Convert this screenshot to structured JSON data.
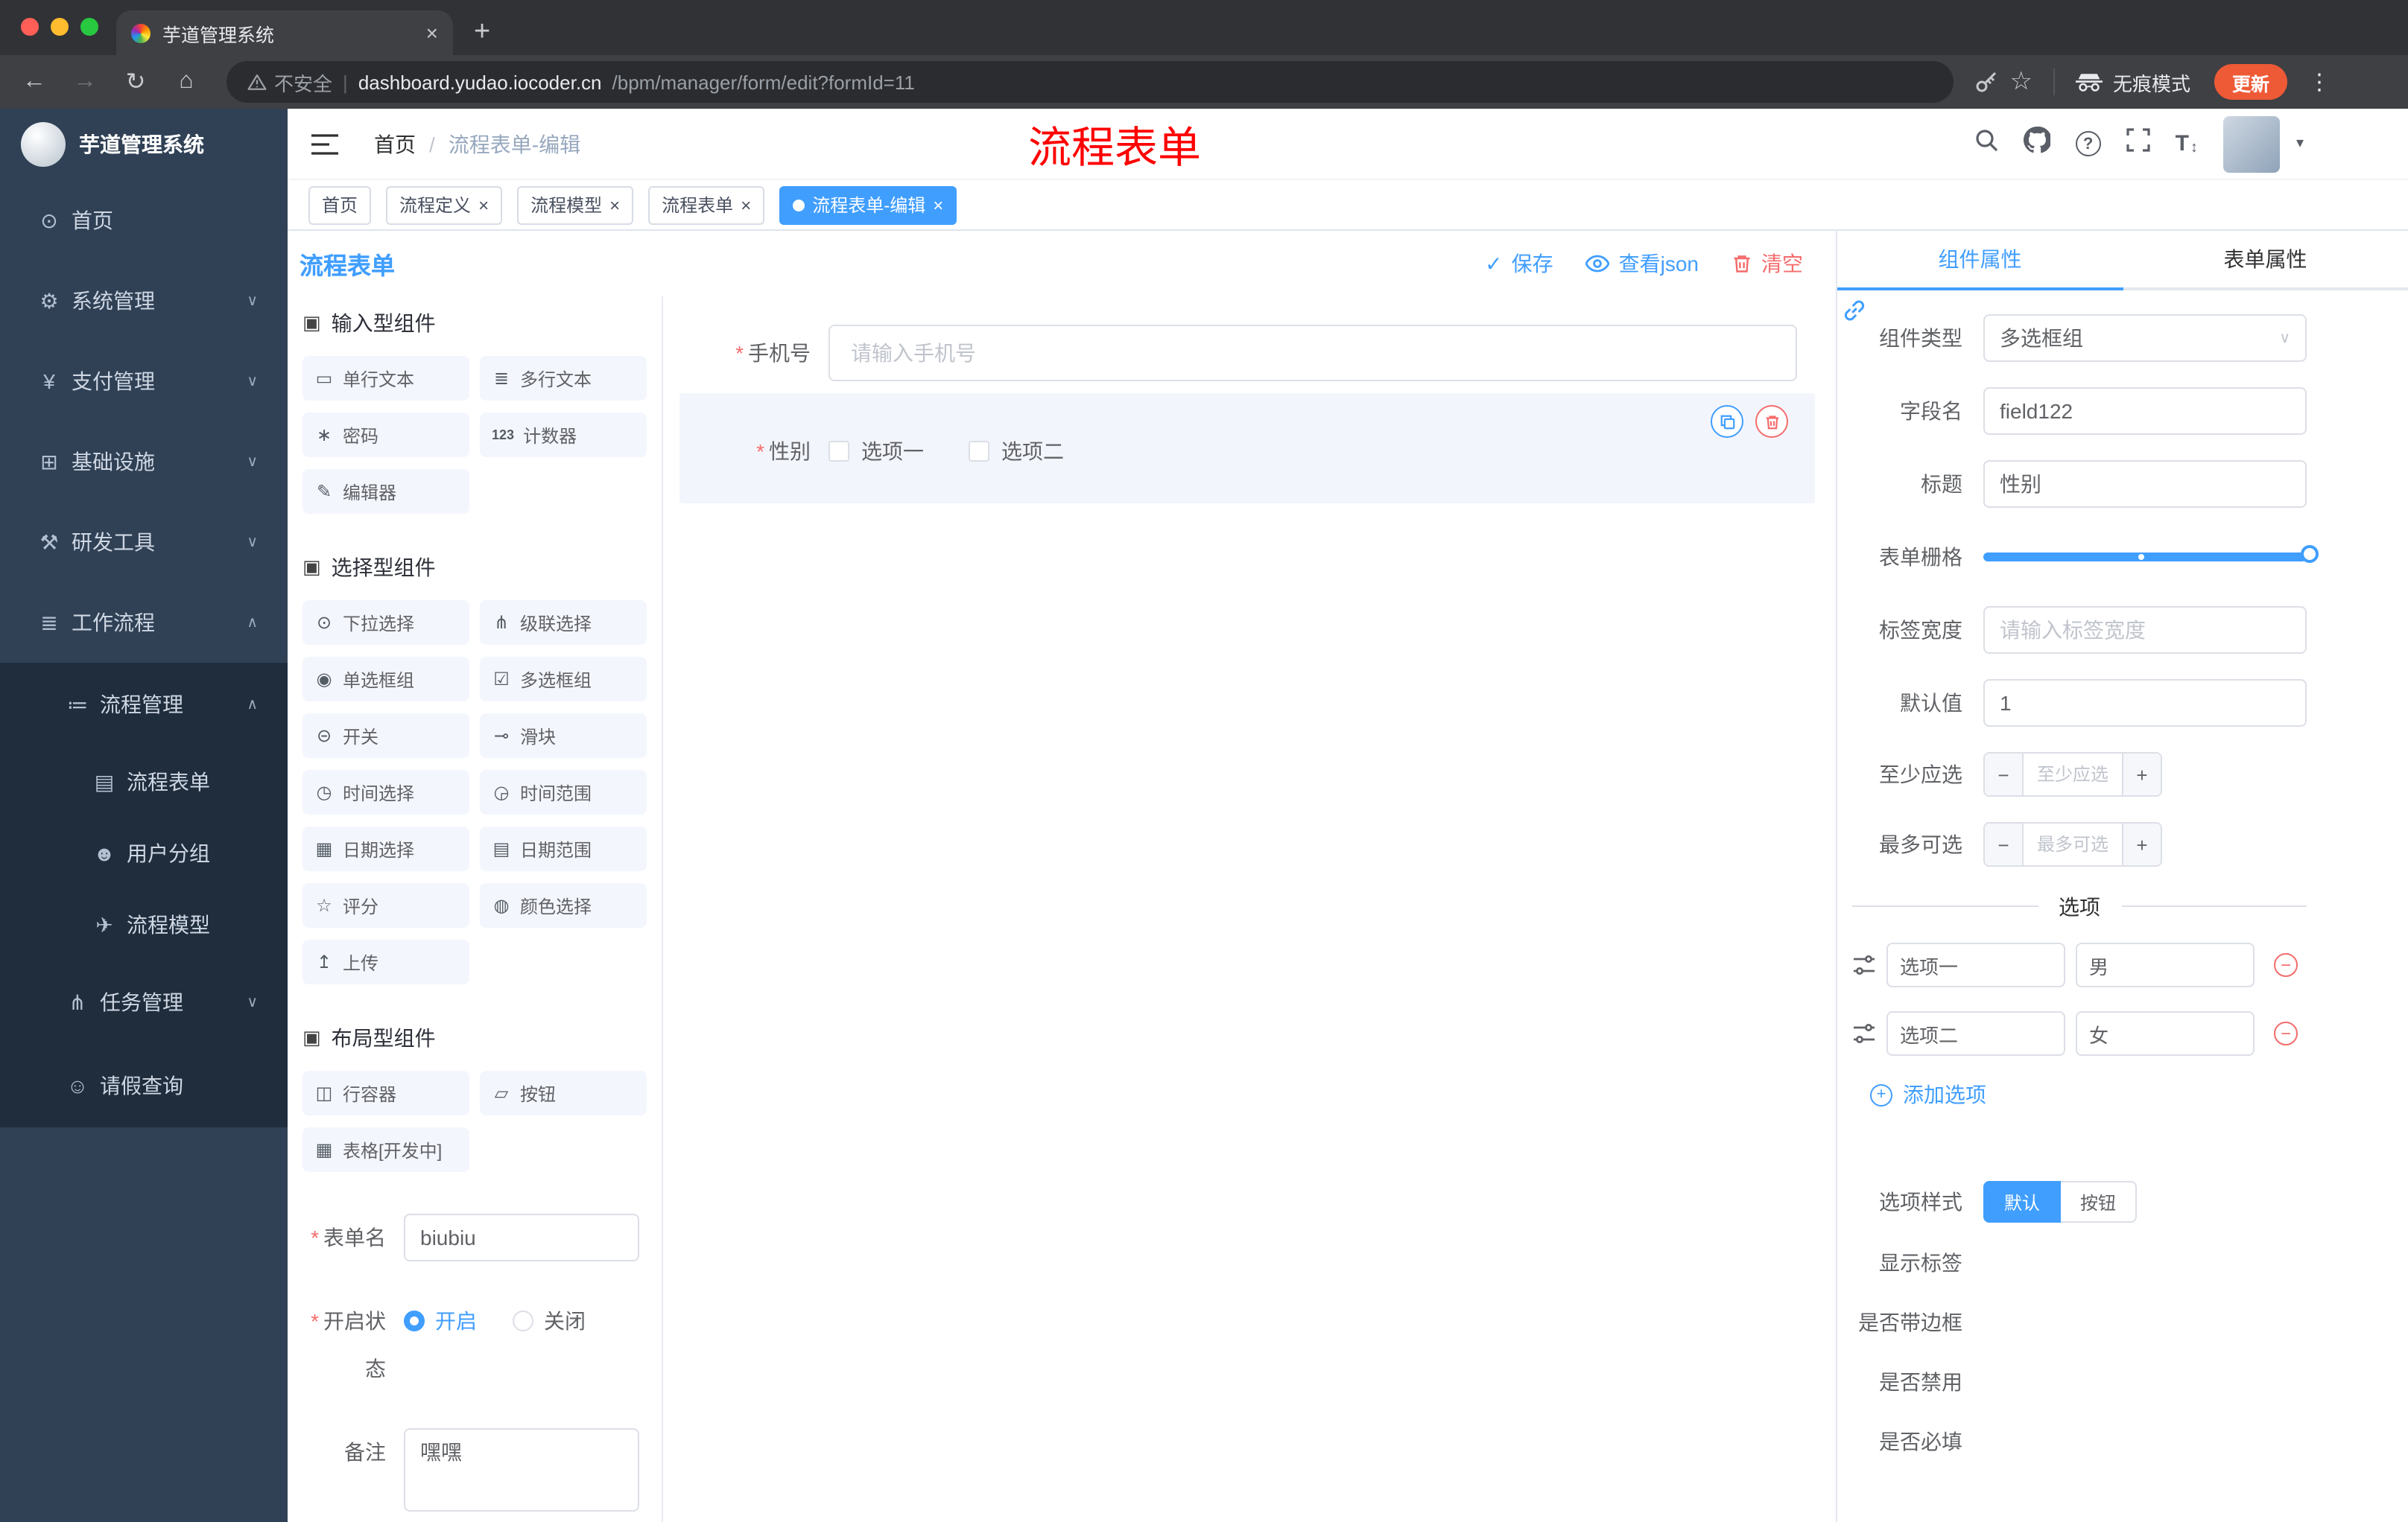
{
  "browser": {
    "tab_title": "芋道管理系统",
    "new_tab": "+",
    "address": {
      "warning_text": "不安全",
      "separator": "|",
      "host": "dashboard.yudao.iocoder.cn",
      "path": "/bpm/manager/form/edit?formId=11"
    },
    "incognito_label": "无痕模式",
    "update_button": "更新"
  },
  "icons": {
    "back": "←",
    "forward": "→",
    "reload": "↻",
    "home": "⌂",
    "star": "☆",
    "menu_dots": "⋮",
    "close": "×",
    "chevron_down": "∨",
    "chevron_up": "∧",
    "select_caret": "∨",
    "caret_down": "▾",
    "question_mark": "?",
    "font_size": "T",
    "font_size_arrows": "↕",
    "check": "✓"
  },
  "app_header": {
    "breadcrumb": {
      "root": "首页",
      "separator": "/",
      "current": "流程表单-编辑"
    },
    "annotation": "流程表单"
  },
  "page_tabs": [
    {
      "label": "首页"
    },
    {
      "label": "流程定义"
    },
    {
      "label": "流程模型"
    },
    {
      "label": "流程表单"
    },
    {
      "label": "流程表单-编辑"
    }
  ],
  "sidebar": {
    "logo_title": "芋道管理系统",
    "items": [
      {
        "label": "首页",
        "icon": "⊙"
      },
      {
        "label": "系统管理",
        "icon": "⚙"
      },
      {
        "label": "支付管理",
        "icon": "¥"
      },
      {
        "label": "基础设施",
        "icon": "⊞"
      },
      {
        "label": "研发工具",
        "icon": "⚒"
      },
      {
        "label": "工作流程",
        "icon": "≣"
      },
      {
        "label": "流程管理",
        "icon": "≔"
      },
      {
        "label": "流程表单",
        "icon": "▤"
      },
      {
        "label": "用户分组",
        "icon": "☻"
      },
      {
        "label": "流程模型",
        "icon": "✈"
      },
      {
        "label": "任务管理",
        "icon": "⋔"
      },
      {
        "label": "请假查询",
        "icon": "☺"
      }
    ]
  },
  "toolbar": {
    "page_title": "流程表单",
    "save_label": "保存",
    "view_json_label": "查看json",
    "clear_label": "清空"
  },
  "palette": {
    "groups": [
      {
        "title": "输入型组件",
        "icon": "▣",
        "items": [
          {
            "label": "单行文本",
            "icon": "▭"
          },
          {
            "label": "多行文本",
            "icon": "≣"
          },
          {
            "label": "密码",
            "icon": "∗"
          },
          {
            "label": "计数器",
            "icon": "123"
          },
          {
            "label": "编辑器",
            "icon": "✎"
          }
        ]
      },
      {
        "title": "选择型组件",
        "icon": "▣",
        "items": [
          {
            "label": "下拉选择",
            "icon": "⊙"
          },
          {
            "label": "级联选择",
            "icon": "⋔"
          },
          {
            "label": "单选框组",
            "icon": "◉"
          },
          {
            "label": "多选框组",
            "icon": "☑"
          },
          {
            "label": "开关",
            "icon": "⊝"
          },
          {
            "label": "滑块",
            "icon": "⊸"
          },
          {
            "label": "时间选择",
            "icon": "◷"
          },
          {
            "label": "时间范围",
            "icon": "◶"
          },
          {
            "label": "日期选择",
            "icon": "▦"
          },
          {
            "label": "日期范围",
            "icon": "▤"
          },
          {
            "label": "评分",
            "icon": "☆"
          },
          {
            "label": "颜色选择",
            "icon": "◍"
          },
          {
            "label": "上传",
            "icon": "↥"
          }
        ]
      },
      {
        "title": "布局型组件",
        "icon": "▣",
        "items": [
          {
            "label": "行容器",
            "icon": "◫"
          },
          {
            "label": "按钮",
            "icon": "▱"
          },
          {
            "label": "表格[开发中]",
            "icon": "▦"
          }
        ]
      }
    ]
  },
  "form_settings": {
    "form_name": {
      "label": "表单名",
      "value": "biubiu"
    },
    "status": {
      "label": "开启状态",
      "options": [
        "开启",
        "关闭"
      ],
      "selected": "开启"
    },
    "remark": {
      "label": "备注",
      "value": "嘿嘿"
    }
  },
  "canvas": {
    "phone_field": {
      "label": "手机号",
      "placeholder": "请输入手机号"
    },
    "gender_widget": {
      "label": "性别",
      "options": [
        "选项一",
        "选项二"
      ]
    }
  },
  "panel": {
    "tabs": [
      {
        "label": "组件属性"
      },
      {
        "label": "表单属性"
      }
    ],
    "component_type": {
      "label": "组件类型",
      "value": "多选框组"
    },
    "field_name": {
      "label": "字段名",
      "value": "field122"
    },
    "title": {
      "label": "标题",
      "value": "性别"
    },
    "form_grid": {
      "label": "表单栅格"
    },
    "label_width": {
      "label": "标签宽度",
      "placeholder": "请输入标签宽度"
    },
    "default_value": {
      "label": "默认值",
      "value": "1"
    },
    "min_select": {
      "label": "至少应选",
      "placeholder": "至少应选",
      "minus": "−",
      "plus": "+"
    },
    "max_select": {
      "label": "最多可选",
      "placeholder": "最多可选",
      "minus": "−",
      "plus": "+"
    },
    "options_section": {
      "title": "选项",
      "rows": [
        {
          "label": "选项一",
          "value": "男"
        },
        {
          "label": "选项二",
          "value": "女"
        }
      ],
      "add_label": "添加选项"
    },
    "option_style": {
      "label": "选项样式",
      "choices": [
        "默认",
        "按钮"
      ],
      "selected": "默认"
    },
    "switches": [
      {
        "label": "显示标签",
        "on": true
      },
      {
        "label": "是否带边框",
        "on": false
      },
      {
        "label": "是否禁用",
        "on": false
      },
      {
        "label": "是否必填",
        "on": true
      }
    ]
  },
  "colors": {
    "accent": "#409eff",
    "danger": "#f56c6c",
    "annotation_red": "#ff0000",
    "sidebar_bg": "#304156",
    "sidebar_sub_bg": "#1f2d3d",
    "update_pill": "#ee5a36"
  }
}
